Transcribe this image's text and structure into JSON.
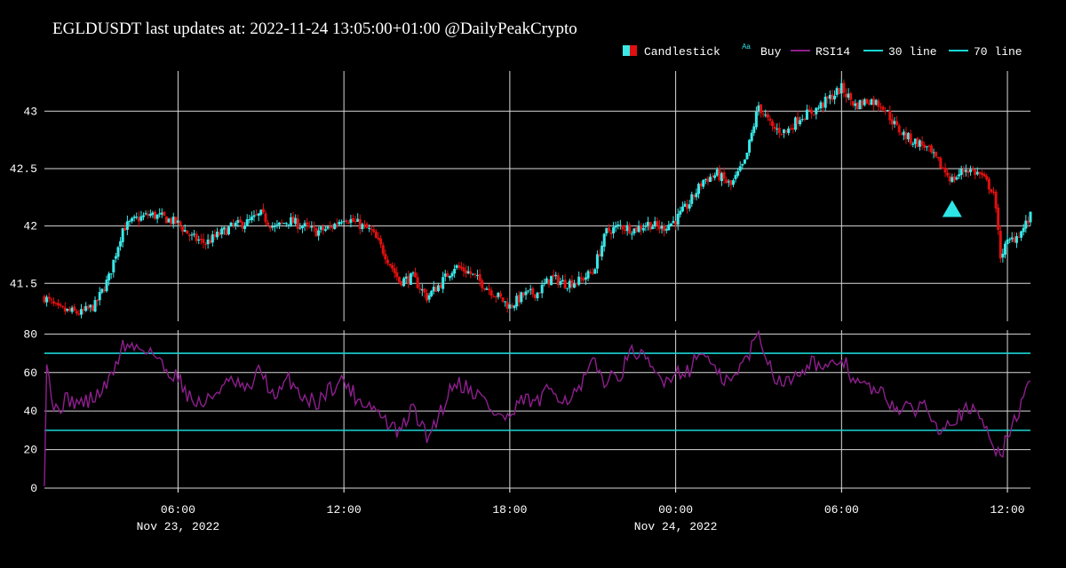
{
  "colors": {
    "background": "#000000",
    "grid": "#d8d8d8",
    "up": "#3ae8e8",
    "down": "#e01010",
    "rsi": "#8e1f8e",
    "threshold": "#19d6d6",
    "buy": "#2ee6e6"
  },
  "legend": {
    "position": "top-right",
    "items": [
      {
        "key": "candle",
        "label": "Candlestick",
        "icon": "candlestick-icon"
      },
      {
        "key": "buy",
        "label": "Buy",
        "icon": "triangle-marker-icon",
        "sample": "Aa"
      },
      {
        "key": "rsi",
        "label": "RSI14",
        "icon": "line-icon"
      },
      {
        "key": "l30",
        "label": "30 line",
        "icon": "line-icon"
      },
      {
        "key": "l70",
        "label": "70 line",
        "icon": "line-icon"
      }
    ]
  },
  "chart_data": {
    "title": "EGLDUSDT last updates at: 2022-11-24 13:05:00+01:00 @DailyPeakCrypto",
    "x_axis": {
      "type": "datetime",
      "range": [
        "2022-11-23 01:10",
        "2022-11-24 12:50"
      ],
      "tick_labels": [
        "06:00",
        "12:00",
        "18:00",
        "00:00",
        "06:00",
        "12:00"
      ],
      "tick_values": [
        "2022-11-23 06:00",
        "2022-11-23 12:00",
        "2022-11-23 18:00",
        "2022-11-24 00:00",
        "2022-11-24 06:00",
        "2022-11-24 12:00"
      ],
      "date_labels": [
        "Nov 23, 2022",
        "Nov 24, 2022"
      ],
      "date_positions": [
        "2022-11-23 06:00",
        "2022-11-24 00:00"
      ]
    },
    "price_panel": {
      "type": "candlestick",
      "ylim": [
        41.17,
        43.35
      ],
      "y_ticks": [
        41.5,
        42,
        42.5,
        43
      ],
      "y_tick_labels": [
        "41.5",
        "42",
        "42.5",
        "43"
      ],
      "grid": true,
      "close_anchors": [
        [
          "2022-11-23 01:10",
          41.38
        ],
        [
          "2022-11-23 01:40",
          41.27
        ],
        [
          "2022-11-23 02:30",
          41.24
        ],
        [
          "2022-11-23 03:00",
          41.31
        ],
        [
          "2022-11-23 03:30",
          41.55
        ],
        [
          "2022-11-23 04:00",
          41.98
        ],
        [
          "2022-11-23 04:30",
          42.06
        ],
        [
          "2022-11-23 05:00",
          42.1
        ],
        [
          "2022-11-23 05:30",
          42.07
        ],
        [
          "2022-11-23 06:00",
          42.02
        ],
        [
          "2022-11-23 06:30",
          41.9
        ],
        [
          "2022-11-23 07:00",
          41.85
        ],
        [
          "2022-11-23 07:30",
          41.93
        ],
        [
          "2022-11-23 08:00",
          42.0
        ],
        [
          "2022-11-23 08:30",
          42.03
        ],
        [
          "2022-11-23 09:00",
          42.1
        ],
        [
          "2022-11-23 09:30",
          41.98
        ],
        [
          "2022-11-23 10:00",
          42.05
        ],
        [
          "2022-11-23 10:30",
          42.0
        ],
        [
          "2022-11-23 11:00",
          41.95
        ],
        [
          "2022-11-23 11:30",
          41.98
        ],
        [
          "2022-11-23 12:00",
          42.08
        ],
        [
          "2022-11-23 12:30",
          42.02
        ],
        [
          "2022-11-23 13:00",
          41.95
        ],
        [
          "2022-11-23 13:30",
          41.75
        ],
        [
          "2022-11-23 14:00",
          41.52
        ],
        [
          "2022-11-23 14:30",
          41.55
        ],
        [
          "2022-11-23 15:00",
          41.38
        ],
        [
          "2022-11-23 15:30",
          41.5
        ],
        [
          "2022-11-23 16:00",
          41.65
        ],
        [
          "2022-11-23 16:30",
          41.6
        ],
        [
          "2022-11-23 17:00",
          41.5
        ],
        [
          "2022-11-23 17:30",
          41.4
        ],
        [
          "2022-11-23 18:00",
          41.3
        ],
        [
          "2022-11-23 18:30",
          41.4
        ],
        [
          "2022-11-23 19:00",
          41.42
        ],
        [
          "2022-11-23 19:30",
          41.55
        ],
        [
          "2022-11-23 20:00",
          41.5
        ],
        [
          "2022-11-23 20:30",
          41.52
        ],
        [
          "2022-11-23 21:00",
          41.6
        ],
        [
          "2022-11-23 21:30",
          41.95
        ],
        [
          "2022-11-23 22:00",
          42.0
        ],
        [
          "2022-11-23 22:30",
          41.97
        ],
        [
          "2022-11-23 23:00",
          42.02
        ],
        [
          "2022-11-23 23:30",
          41.98
        ],
        [
          "2022-11-24 00:00",
          42.05
        ],
        [
          "2022-11-24 00:30",
          42.2
        ],
        [
          "2022-11-24 01:00",
          42.4
        ],
        [
          "2022-11-24 01:30",
          42.45
        ],
        [
          "2022-11-24 02:00",
          42.35
        ],
        [
          "2022-11-24 02:30",
          42.55
        ],
        [
          "2022-11-24 03:00",
          43.05
        ],
        [
          "2022-11-24 03:30",
          42.85
        ],
        [
          "2022-11-24 04:00",
          42.82
        ],
        [
          "2022-11-24 04:30",
          42.95
        ],
        [
          "2022-11-24 05:00",
          43.0
        ],
        [
          "2022-11-24 05:30",
          43.1
        ],
        [
          "2022-11-24 06:00",
          43.2
        ],
        [
          "2022-11-24 06:30",
          43.05
        ],
        [
          "2022-11-24 07:00",
          43.1
        ],
        [
          "2022-11-24 07:30",
          43.05
        ],
        [
          "2022-11-24 08:00",
          42.85
        ],
        [
          "2022-11-24 08:30",
          42.75
        ],
        [
          "2022-11-24 09:00",
          42.7
        ],
        [
          "2022-11-24 09:30",
          42.55
        ],
        [
          "2022-11-24 10:00",
          42.4
        ],
        [
          "2022-11-24 10:30",
          42.5
        ],
        [
          "2022-11-24 11:00",
          42.45
        ],
        [
          "2022-11-24 11:30",
          42.3
        ],
        [
          "2022-11-24 11:45",
          41.75
        ],
        [
          "2022-11-24 12:00",
          41.85
        ],
        [
          "2022-11-24 12:30",
          41.95
        ],
        [
          "2022-11-24 12:50",
          42.08
        ]
      ],
      "buy_markers": [
        {
          "x": "2022-11-24 10:00",
          "y": 42.14
        }
      ]
    },
    "rsi_panel": {
      "type": "line",
      "ylim": [
        0,
        82
      ],
      "y_ticks": [
        0,
        20,
        40,
        60,
        80
      ],
      "y_tick_labels": [
        "0",
        "20",
        "40",
        "60",
        "80"
      ],
      "grid": true,
      "lines": [
        {
          "name": "30 line",
          "y": 30
        },
        {
          "name": "70 line",
          "y": 70
        }
      ],
      "rsi_anchors": [
        [
          "2022-11-23 01:10",
          2
        ],
        [
          "2022-11-23 01:15",
          68
        ],
        [
          "2022-11-23 01:30",
          40
        ],
        [
          "2022-11-23 02:00",
          46
        ],
        [
          "2022-11-23 02:30",
          44
        ],
        [
          "2022-11-23 03:00",
          47
        ],
        [
          "2022-11-23 03:30",
          55
        ],
        [
          "2022-11-23 04:00",
          74
        ],
        [
          "2022-11-23 04:30",
          73
        ],
        [
          "2022-11-23 05:00",
          72
        ],
        [
          "2022-11-23 05:30",
          62
        ],
        [
          "2022-11-23 06:00",
          58
        ],
        [
          "2022-11-23 06:30",
          45
        ],
        [
          "2022-11-23 07:00",
          44
        ],
        [
          "2022-11-23 07:30",
          52
        ],
        [
          "2022-11-23 08:00",
          55
        ],
        [
          "2022-11-23 08:30",
          50
        ],
        [
          "2022-11-23 09:00",
          62
        ],
        [
          "2022-11-23 09:30",
          45
        ],
        [
          "2022-11-23 10:00",
          57
        ],
        [
          "2022-11-23 10:30",
          48
        ],
        [
          "2022-11-23 11:00",
          44
        ],
        [
          "2022-11-23 11:30",
          52
        ],
        [
          "2022-11-23 12:00",
          56
        ],
        [
          "2022-11-23 12:30",
          46
        ],
        [
          "2022-11-23 13:00",
          43
        ],
        [
          "2022-11-23 13:30",
          35
        ],
        [
          "2022-11-23 14:00",
          28
        ],
        [
          "2022-11-23 14:30",
          42
        ],
        [
          "2022-11-23 15:00",
          26
        ],
        [
          "2022-11-23 15:30",
          40
        ],
        [
          "2022-11-23 16:00",
          56
        ],
        [
          "2022-11-23 16:30",
          52
        ],
        [
          "2022-11-23 17:00",
          47
        ],
        [
          "2022-11-23 17:30",
          38
        ],
        [
          "2022-11-23 18:00",
          36
        ],
        [
          "2022-11-23 18:30",
          46
        ],
        [
          "2022-11-23 19:00",
          44
        ],
        [
          "2022-11-23 19:30",
          52
        ],
        [
          "2022-11-23 20:00",
          46
        ],
        [
          "2022-11-23 20:30",
          50
        ],
        [
          "2022-11-23 21:00",
          65
        ],
        [
          "2022-11-23 21:30",
          55
        ],
        [
          "2022-11-23 22:00",
          60
        ],
        [
          "2022-11-23 22:30",
          72
        ],
        [
          "2022-11-23 23:00",
          64
        ],
        [
          "2022-11-23 23:30",
          56
        ],
        [
          "2022-11-24 00:00",
          60
        ],
        [
          "2022-11-24 00:30",
          62
        ],
        [
          "2022-11-24 01:00",
          72
        ],
        [
          "2022-11-24 01:30",
          58
        ],
        [
          "2022-11-24 02:00",
          55
        ],
        [
          "2022-11-24 02:30",
          66
        ],
        [
          "2022-11-24 03:00",
          80
        ],
        [
          "2022-11-24 03:30",
          60
        ],
        [
          "2022-11-24 04:00",
          54
        ],
        [
          "2022-11-24 04:30",
          62
        ],
        [
          "2022-11-24 05:00",
          66
        ],
        [
          "2022-11-24 05:30",
          60
        ],
        [
          "2022-11-24 06:00",
          68
        ],
        [
          "2022-11-24 06:30",
          55
        ],
        [
          "2022-11-24 07:00",
          52
        ],
        [
          "2022-11-24 07:30",
          48
        ],
        [
          "2022-11-24 08:00",
          42
        ],
        [
          "2022-11-24 08:30",
          40
        ],
        [
          "2022-11-24 09:00",
          44
        ],
        [
          "2022-11-24 09:30",
          32
        ],
        [
          "2022-11-24 10:00",
          36
        ],
        [
          "2022-11-24 10:30",
          40
        ],
        [
          "2022-11-24 11:00",
          38
        ],
        [
          "2022-11-24 11:30",
          24
        ],
        [
          "2022-11-24 11:45",
          15
        ],
        [
          "2022-11-24 12:00",
          27
        ],
        [
          "2022-11-24 12:30",
          43
        ],
        [
          "2022-11-24 12:50",
          55
        ]
      ]
    }
  }
}
